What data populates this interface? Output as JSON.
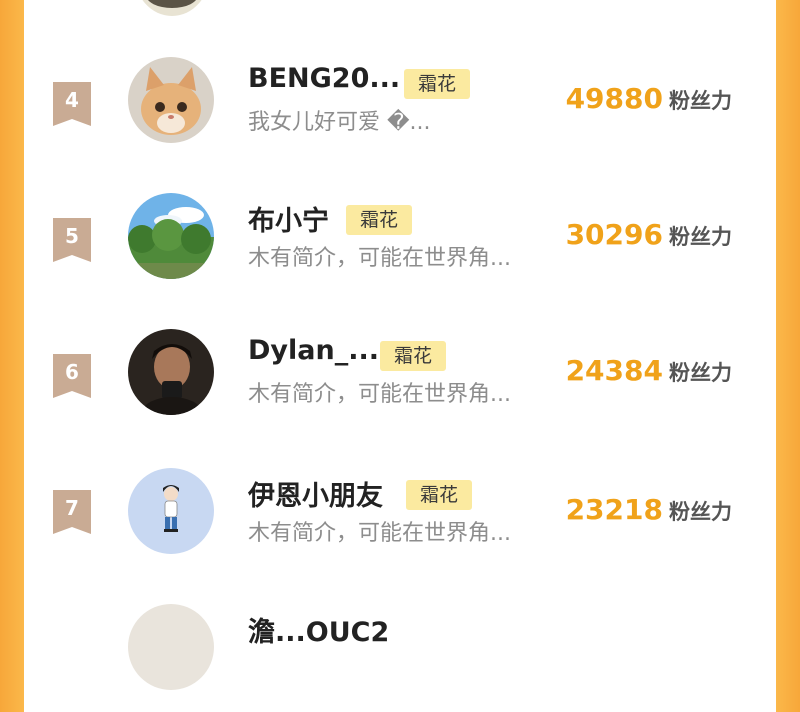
{
  "list": {
    "rows": [
      {
        "rank": "4",
        "name": "BENG20...",
        "tag": "霜花",
        "bio": "我女儿好可爱 �...",
        "fans_count": "49880",
        "fans_label": "粉丝力",
        "avatar_icon": "cat-photo-avatar"
      },
      {
        "rank": "5",
        "name": "布小宁",
        "tag": "霜花",
        "bio": "木有简介，可能在世界角...",
        "fans_count": "30296",
        "fans_label": "粉丝力",
        "avatar_icon": "landscape-photo-avatar"
      },
      {
        "rank": "6",
        "name": "Dylan_...",
        "tag": "霜花",
        "bio": "木有简介，可能在世界角...",
        "fans_count": "24384",
        "fans_label": "粉丝力",
        "avatar_icon": "person-photo-avatar"
      },
      {
        "rank": "7",
        "name": "伊恩小朋友",
        "tag": "霜花",
        "bio": "木有简介，可能在世界角...",
        "fans_count": "23218",
        "fans_label": "粉丝力",
        "avatar_icon": "cartoon-avatar"
      }
    ],
    "partial_bottom_name": "澹...OUC2"
  },
  "colors": {
    "side_accent": "#f7a73a",
    "rank_badge": "#c9ab94",
    "tag_bg": "#fbeaa0",
    "fans_number": "#f0a21a"
  }
}
